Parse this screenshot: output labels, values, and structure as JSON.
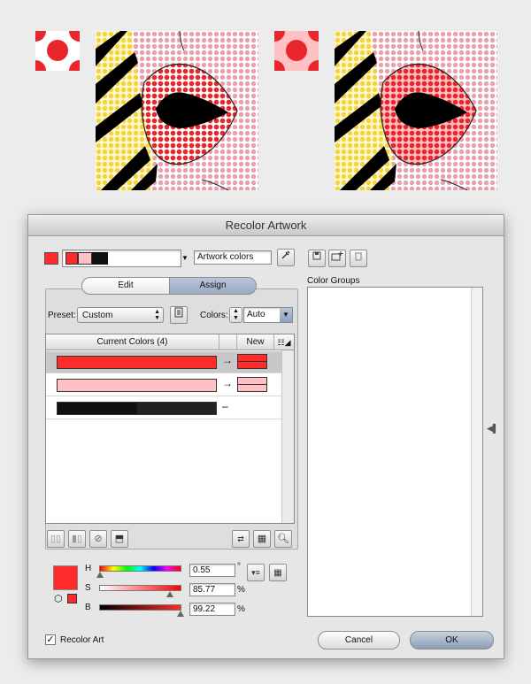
{
  "dialog": {
    "title": "Recolor Artwork",
    "color_group_name": "Artwork colors",
    "tabs": {
      "edit": "Edit",
      "assign": "Assign"
    },
    "preset_label": "Preset:",
    "preset_value": "Custom",
    "colors_label": "Colors:",
    "colors_value": "Auto",
    "table": {
      "current_header": "Current Colors (4)",
      "new_header": "New",
      "rows": [
        {
          "current": "#ff2a2a",
          "new": "#ff2a2a",
          "arrow": "→",
          "selected": true
        },
        {
          "current": "#ffc1c4",
          "new": "#ffc1c4",
          "arrow": "→",
          "selected": false
        },
        {
          "current": "#111111",
          "new": "",
          "arrow": "–",
          "selected": false
        }
      ]
    },
    "hsb": {
      "h_label": "H",
      "s_label": "S",
      "b_label": "B",
      "h_value": "0.55",
      "s_value": "85.77",
      "b_value": "99.22",
      "h_unit": "°",
      "s_unit": "%",
      "b_unit": "%",
      "h_level": 0.0015,
      "s_level": 0.8577,
      "b_level": 0.9922
    },
    "active_color": "#ff2a2a",
    "color_groups_label": "Color Groups",
    "recolor_art_label": "Recolor Art",
    "recolor_art_checked": true,
    "cancel_label": "Cancel",
    "ok_label": "OK"
  },
  "illustration": {
    "accent_red": "#e8262b",
    "dot_pink": "#e8a0aa",
    "dot_yellow": "#f2d43b"
  }
}
